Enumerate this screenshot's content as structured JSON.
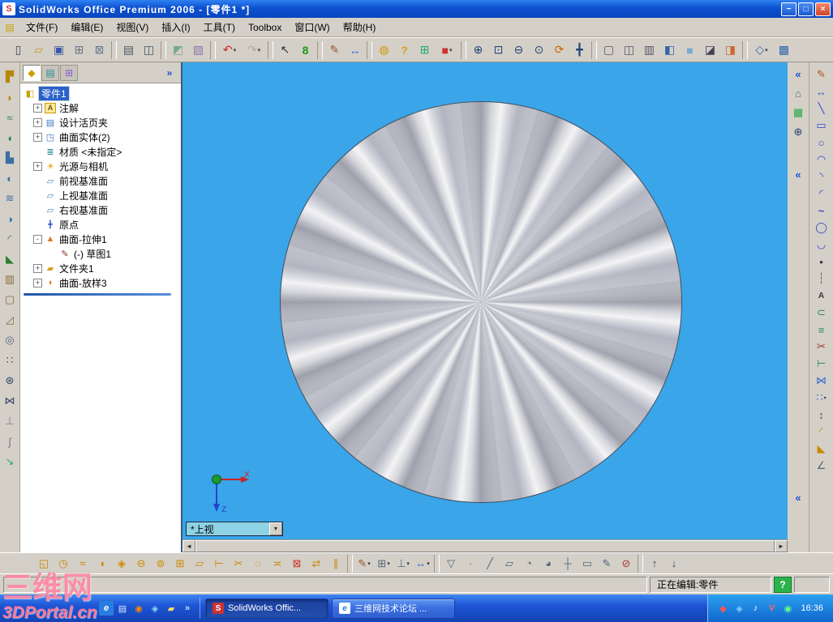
{
  "window": {
    "title": "SolidWorks Office Premium 2006 - [零件1 *]",
    "logo_glyph": "S",
    "controls": [
      {
        "n": "minimize-button",
        "g": "−",
        "cl": "wbtn"
      },
      {
        "n": "restore-button",
        "g": "□",
        "cl": "wbtn"
      },
      {
        "n": "close-button",
        "g": "×",
        "cl": "wbtn close"
      }
    ]
  },
  "menu": {
    "doc_icon_glyph": "▤",
    "items": [
      {
        "n": "menu-item-file",
        "label": "文件(F)"
      },
      {
        "n": "menu-item-edit",
        "label": "编辑(E)"
      },
      {
        "n": "menu-item-view",
        "label": "视图(V)"
      },
      {
        "n": "menu-item-insert",
        "label": "插入(I)"
      },
      {
        "n": "menu-item-tools",
        "label": "工具(T)"
      },
      {
        "n": "menu-item-toolbox",
        "label": "Toolbox"
      },
      {
        "n": "menu-item-window",
        "label": "窗口(W)"
      },
      {
        "n": "menu-item-help",
        "label": "帮助(H)"
      }
    ]
  },
  "toolbar_main": {
    "items": [
      {
        "n": "new-icon",
        "g": "▯",
        "st": "color:#444455"
      },
      {
        "n": "open-icon",
        "g": "▱",
        "st": "color:#c9992a"
      },
      {
        "n": "save-icon",
        "g": "▣",
        "st": "color:#3a57a8"
      },
      {
        "n": "make-drawing-icon",
        "g": "⊞",
        "st": "color:#667788"
      },
      {
        "n": "make-assembly-icon",
        "g": "⊠",
        "st": "color:#667788"
      },
      {
        "n": "separator",
        "cl": "tsep",
        "it": "false"
      },
      {
        "n": "print-icon",
        "g": "▤",
        "st": "color:#445566"
      },
      {
        "n": "print-preview-icon",
        "g": "◫",
        "st": "color:#445566"
      },
      {
        "n": "separator",
        "cl": "tsep",
        "it": "false"
      },
      {
        "n": "edit-color-icon",
        "g": "◩",
        "st": "color:#77aa88"
      },
      {
        "n": "texture-icon",
        "g": "▨",
        "st": "color:#8877aa"
      },
      {
        "n": "separator",
        "cl": "tsep",
        "it": "false"
      },
      {
        "n": "undo-icon",
        "g": "↶",
        "st": "color:#cc2222",
        "cl": "tbtn drop"
      },
      {
        "n": "redo-icon",
        "g": "↷",
        "st": "color:#aaaaaa",
        "cl": "tbtn drop"
      },
      {
        "n": "separator",
        "cl": "tsep",
        "it": "false"
      },
      {
        "n": "select-icon",
        "g": "↖",
        "st": "color:#223344"
      },
      {
        "n": "rebuild-icon",
        "g": "8",
        "st": "color:#1a9a1a;font-weight:bold"
      },
      {
        "n": "separator",
        "cl": "tsep",
        "it": "false"
      },
      {
        "n": "sketch-icon",
        "g": "✎",
        "st": "color:#995533"
      },
      {
        "n": "dimension-icon",
        "g": "↔",
        "st": "color:#3366cc"
      },
      {
        "n": "separator",
        "cl": "tsep",
        "it": "false"
      },
      {
        "n": "photoworks-icon",
        "g": "◍",
        "st": "color:#cc9900"
      },
      {
        "n": "help-topic-icon",
        "g": "?",
        "st": "color:#d4a017;font-weight:bold"
      },
      {
        "n": "design-table-icon",
        "g": "⊞",
        "st": "color:#22aa66"
      },
      {
        "n": "red-cube-icon",
        "g": "■",
        "st": "color:#cc3333",
        "cl": "tbtn drop"
      },
      {
        "n": "separator",
        "cl": "tsep",
        "it": "false"
      },
      {
        "n": "zoom-to-fit-icon",
        "g": "⊕",
        "st": "color:#224477"
      },
      {
        "n": "zoom-area-icon",
        "g": "⊡",
        "st": "color:#224477"
      },
      {
        "n": "zoom-in-out-icon",
        "g": "⊖",
        "st": "color:#224477"
      },
      {
        "n": "zoom-to-selection-icon",
        "g": "⊙",
        "st": "color:#224477"
      },
      {
        "n": "rotate-view-icon",
        "g": "⟳",
        "st": "color:#cc6600"
      },
      {
        "n": "pan-icon",
        "g": "╋",
        "st": "color:#224477"
      },
      {
        "n": "separator",
        "cl": "tsep",
        "it": "false"
      },
      {
        "n": "wireframe-icon",
        "g": "▢",
        "st": "color:#555566"
      },
      {
        "n": "hidden-lines-visible-icon",
        "g": "◫",
        "st": "color:#555566"
      },
      {
        "n": "hidden-lines-removed-icon",
        "g": "▥",
        "st": "color:#555566"
      },
      {
        "n": "shaded-with-edges-icon",
        "g": "◧",
        "st": "color:#3366aa"
      },
      {
        "n": "shaded-icon",
        "g": "■",
        "st": "color:#77aacc"
      },
      {
        "n": "shadows-icon",
        "g": "◪",
        "st": "color:#444455"
      },
      {
        "n": "section-view-icon",
        "g": "◨",
        "st": "color:#cc6633"
      },
      {
        "n": "separator",
        "cl": "tsep",
        "it": "false"
      },
      {
        "n": "standard-views-icon",
        "g": "◇",
        "st": "color:#3366aa",
        "cl": "tbtn drop"
      },
      {
        "n": "help-icon",
        "g": "▩",
        "st": "color:#3366aa"
      }
    ]
  },
  "left_toolbar": {
    "items": [
      {
        "n": "extruded-boss-icon",
        "g": "▛",
        "st": "color:#b8860b"
      },
      {
        "n": "revolved-boss-icon",
        "g": "◗",
        "st": "color:#b8860b"
      },
      {
        "n": "swept-boss-icon",
        "g": "≈",
        "st": "color:#2e7d52"
      },
      {
        "n": "lofted-boss-icon",
        "g": "◖",
        "st": "color:#2e7d52"
      },
      {
        "n": "extruded-cut-icon",
        "g": "▙",
        "st": "color:#3b6ea5"
      },
      {
        "n": "revolved-cut-icon",
        "g": "◐",
        "st": "color:#3b6ea5"
      },
      {
        "n": "swept-cut-icon",
        "g": "≋",
        "st": "color:#3b6ea5"
      },
      {
        "n": "lofted-cut-icon",
        "g": "◑",
        "st": "color:#3b6ea5"
      },
      {
        "n": "fillet-icon",
        "g": "◜",
        "st": "color:#2e7d32"
      },
      {
        "n": "chamfer-icon",
        "g": "◣",
        "st": "color:#2e7d32"
      },
      {
        "n": "rib-icon",
        "g": "▥",
        "st": "color:#8a6d3b"
      },
      {
        "n": "shell-icon",
        "g": "▢",
        "st": "color:#8a6d3b"
      },
      {
        "n": "draft-icon",
        "g": "◿",
        "st": "color:#8a6d3b"
      },
      {
        "n": "hole-wizard-icon",
        "g": "◎",
        "st": "color:#556677"
      },
      {
        "n": "linear-pattern-icon",
        "g": "∷",
        "st": "color:#334466"
      },
      {
        "n": "circular-pattern-icon",
        "g": "⊛",
        "st": "color:#334466"
      },
      {
        "n": "mirror-feature-icon",
        "g": "⋈",
        "st": "color:#334466"
      },
      {
        "n": "reference-geometry-icon",
        "g": "⊥",
        "st": "color:#777788"
      },
      {
        "n": "curves-icon",
        "g": "∫",
        "st": "color:#777788"
      },
      {
        "n": "instant3d-icon",
        "g": "↘",
        "st": "color:#22aa77"
      }
    ]
  },
  "right_toolbar": {
    "items": [
      {
        "n": "sketch-pencil-icon",
        "g": "✎",
        "st": "color:#aa5522"
      },
      {
        "n": "smart-dimension-icon",
        "g": "↔",
        "st": "color:#3366cc"
      },
      {
        "n": "line-icon",
        "g": "╲",
        "st": "color:#3344cc"
      },
      {
        "n": "rectangle-icon",
        "g": "▭",
        "st": "color:#3344cc"
      },
      {
        "n": "circle-icon",
        "g": "○",
        "st": "color:#3344cc"
      },
      {
        "n": "centerpoint-arc-icon",
        "g": "◠",
        "st": "color:#3344cc"
      },
      {
        "n": "tangent-arc-icon",
        "g": "◝",
        "st": "color:#3344cc"
      },
      {
        "n": "three-point-arc-icon",
        "g": "◜",
        "st": "color:#3344cc"
      },
      {
        "n": "spline-icon",
        "g": "~",
        "st": "color:#3344cc;font-weight:bold"
      },
      {
        "n": "ellipse-icon",
        "g": "◯",
        "st": "color:#3344cc"
      },
      {
        "n": "parabola-icon",
        "g": "◡",
        "st": "color:#3344cc"
      },
      {
        "n": "point-icon",
        "g": "•",
        "st": "color:#333344"
      },
      {
        "n": "centerline-icon",
        "g": "┆",
        "st": "color:#666677"
      },
      {
        "n": "sketch-text-icon",
        "g": "A",
        "st": "color:#333344;font-weight:bold;font-size:10px"
      },
      {
        "n": "convert-entities-icon",
        "g": "⊂",
        "st": "color:#338855"
      },
      {
        "n": "offset-entities-icon",
        "g": "≡",
        "st": "color:#338855"
      },
      {
        "n": "trim-entities-icon",
        "g": "✂",
        "st": "color:#aa3333"
      },
      {
        "n": "extend-entities-icon",
        "g": "⊢",
        "st": "color:#338855"
      },
      {
        "n": "mirror-entities-icon",
        "g": "⋈",
        "st": "color:#3366cc"
      },
      {
        "n": "linear-sketch-pattern-icon",
        "g": "∷",
        "st": "color:#3366cc",
        "cl": "vbtn drop"
      },
      {
        "n": "move-entities-icon",
        "g": "↕",
        "st": "color:#556677"
      },
      {
        "n": "sketch-fillet-icon",
        "g": "◜",
        "st": "color:#cc8800"
      },
      {
        "n": "sketch-chamfer-icon",
        "g": "◣",
        "st": "color:#cc8800"
      },
      {
        "n": "display-relations-icon",
        "g": "∠",
        "st": "color:#556677"
      }
    ]
  },
  "side_buttons": {
    "items": [
      {
        "n": "collapse-panel-button",
        "g": "«",
        "st": "color:#2255cc;font-weight:bold"
      },
      {
        "n": "home-view-button",
        "g": "⌂",
        "st": "color:#556677"
      },
      {
        "n": "appearance-palette-button",
        "g": "▦",
        "st": "color:#22aa44"
      },
      {
        "n": "magnifier-button",
        "g": "⊕",
        "st": "color:#224477"
      },
      {
        "n": "collapse-mid-button",
        "g": "«",
        "st": "color:#2255cc;font-weight:bold;margin-top:28px"
      },
      {
        "n": "collapse-bottom-button",
        "g": "«",
        "st": "color:#2255cc;font-weight:bold;margin-top:auto;margin-bottom:52px"
      }
    ]
  },
  "feature_tree": {
    "tabs": [
      {
        "n": "featuremanager-tab",
        "g": "◆",
        "st": "color:#c8a000",
        "cl": "ttab active"
      },
      {
        "n": "propertymanager-tab",
        "g": "▤",
        "st": "color:#2a8a8a"
      },
      {
        "n": "configurationmanager-tab",
        "g": "⊞",
        "st": "color:#8a5ac8"
      }
    ],
    "expand_glyph": "»",
    "root_label": "零件1",
    "root_glyph": "◧",
    "items": [
      {
        "row": "tree-item-annotations",
        "exp": "+",
        "expcls": "texp box",
        "icon": "annotations-icon",
        "g": "A",
        "ist": "color:#7a5a00;background:#ffe9a0;border:1px solid #c8a000;font-size:9px;font-weight:bold",
        "label": "注解"
      },
      {
        "row": "tree-item-design-binder",
        "exp": "+",
        "expcls": "texp box",
        "icon": "design-binder-icon",
        "g": "▤",
        "ist": "color:#3a7ac8",
        "label": "设计活页夹"
      },
      {
        "row": "tree-item-surface-bodies",
        "exp": "+",
        "expcls": "texp box",
        "icon": "surface-bodies-icon",
        "g": "◳",
        "ist": "color:#3a7ac8",
        "label": "曲面实体(2)"
      },
      {
        "row": "tree-item-material",
        "icon": "material-icon",
        "g": "≣",
        "ist": "color:#2a8a8a",
        "label": "材质 <未指定>"
      },
      {
        "row": "tree-item-lights-cameras",
        "exp": "+",
        "expcls": "texp box",
        "icon": "lights-cameras-icon",
        "g": "☀",
        "ist": "color:#e8a000",
        "label": "光源与相机"
      },
      {
        "row": "tree-item-front-plane",
        "icon": "front-plane-icon",
        "g": "▱",
        "ist": "color:#3a8ab0",
        "label": "前视基准面"
      },
      {
        "row": "tree-item-top-plane",
        "icon": "top-plane-icon",
        "g": "▱",
        "ist": "color:#3a8ab0",
        "label": "上视基准面"
      },
      {
        "row": "tree-item-right-plane",
        "icon": "right-plane-icon",
        "g": "▱",
        "ist": "color:#3a8ab0",
        "label": "右视基准面"
      },
      {
        "row": "tree-item-origin",
        "icon": "origin-icon",
        "g": "╋",
        "ist": "color:#2244cc;font-size:9px",
        "label": "原点"
      },
      {
        "row": "tree-item-surface-extrude1",
        "exp": "-",
        "expcls": "texp box",
        "icon": "surface-extrude-icon",
        "g": "▲",
        "ist": "color:#e07820",
        "label": "曲面-拉伸1"
      },
      {
        "row": "tree-item-sketch1",
        "pad": "padding-left:34px",
        "icon": "sketch1-icon",
        "g": "✎",
        "ist": "color:#883322",
        "label": "(-) 草图1"
      },
      {
        "row": "tree-item-folder1",
        "exp": "+",
        "expcls": "texp box",
        "icon": "folder-icon",
        "g": "▰",
        "ist": "color:#d8a020",
        "label": "文件夹1"
      },
      {
        "row": "tree-item-surface-loft3",
        "exp": "+",
        "expcls": "texp box",
        "icon": "surface-loft-icon",
        "g": "◖",
        "ist": "color:#e07820",
        "label": "曲面-放样3"
      }
    ]
  },
  "viewport": {
    "view_selector": "*上视",
    "dropdown_glyph": "▼",
    "scroll_left_glyph": "◄",
    "scroll_right_glyph": "►",
    "triad_x_label": "X",
    "triad_z_label": "Z"
  },
  "bottom_toolbar": {
    "items": [
      {
        "n": "extruded-surface-icon",
        "g": "◱",
        "st": "color:#cc8800"
      },
      {
        "n": "revolved-surface-icon",
        "g": "◷",
        "st": "color:#cc8800"
      },
      {
        "n": "swept-surface-icon",
        "g": "≈",
        "st": "color:#cc8800"
      },
      {
        "n": "lofted-surface-icon",
        "g": "◖",
        "st": "color:#cc8800"
      },
      {
        "n": "boundary-surface-icon",
        "g": "◈",
        "st": "color:#cc8800"
      },
      {
        "n": "offset-surface-icon",
        "g": "⊖",
        "st": "color:#cc8800"
      },
      {
        "n": "radiate-surface-icon",
        "g": "⊚",
        "st": "color:#cc8800"
      },
      {
        "n": "knit-surface-icon",
        "g": "⊞",
        "st": "color:#cc8800"
      },
      {
        "n": "planar-surface-icon",
        "g": "▱",
        "st": "color:#cc8800"
      },
      {
        "n": "extend-surface-icon",
        "g": "⊢",
        "st": "color:#cc8800"
      },
      {
        "n": "trim-surface-icon",
        "g": "✂",
        "st": "color:#cc8800"
      },
      {
        "n": "untrim-surface-icon",
        "g": "◌",
        "st": "color:#cc8800"
      },
      {
        "n": "mid-surface-icon",
        "g": "≍",
        "st": "color:#cc8800"
      },
      {
        "n": "delete-face-icon",
        "g": "⊠",
        "st": "color:#cc3333"
      },
      {
        "n": "replace-face-icon",
        "g": "⇄",
        "st": "color:#cc8800"
      },
      {
        "n": "ruled-surface-icon",
        "g": "∥",
        "st": "color:#cc8800"
      },
      {
        "n": "separator",
        "cl": "tsep",
        "it": "false"
      },
      {
        "n": "sketch-dropdown-icon",
        "g": "✎",
        "st": "color:#995533",
        "cl": "tbtn drop"
      },
      {
        "n": "grid-system-icon",
        "g": "⊞",
        "st": "color:#556677",
        "cl": "tbtn drop"
      },
      {
        "n": "relations-dropdown-icon",
        "g": "⊥",
        "st": "color:#556677",
        "cl": "tbtn drop"
      },
      {
        "n": "dimension-dropdown-icon",
        "g": "↔",
        "st": "color:#3366cc",
        "cl": "tbtn drop"
      },
      {
        "n": "separator",
        "cl": "tsep",
        "it": "false"
      },
      {
        "n": "filter-toggle-icon",
        "g": "▽",
        "st": "color:#556677"
      },
      {
        "n": "filter-vertices-icon",
        "g": "∙",
        "st": "color:#556677"
      },
      {
        "n": "filter-edges-icon",
        "g": "╱",
        "st": "color:#556677"
      },
      {
        "n": "filter-faces-icon",
        "g": "▱",
        "st": "color:#556677"
      },
      {
        "n": "filter-surface-bodies-icon",
        "g": "◔",
        "st": "color:#556677"
      },
      {
        "n": "filter-solid-bodies-icon",
        "g": "◕",
        "st": "color:#556677"
      },
      {
        "n": "filter-axes-icon",
        "g": "┼",
        "st": "color:#556677"
      },
      {
        "n": "filter-planes-icon",
        "g": "▭",
        "st": "color:#556677"
      },
      {
        "n": "filter-sketches-icon",
        "g": "✎",
        "st": "color:#556677"
      },
      {
        "n": "filter-clear-icon",
        "g": "⊘",
        "st": "color:#aa3333"
      },
      {
        "n": "separator",
        "cl": "tsep",
        "it": "false"
      },
      {
        "n": "dock-up-icon",
        "g": "↑",
        "st": "color:#334455"
      },
      {
        "n": "dock-down-icon",
        "g": "↓",
        "st": "color:#334455"
      }
    ]
  },
  "status_bar": {
    "editing": "正在编辑:零件",
    "help_glyph": "?"
  },
  "taskbar": {
    "quick_launch": [
      {
        "n": "internet-explorer-icon",
        "g": "e",
        "st": "color:#fff;background:#2a7de0;font-style:italic;font-weight:bold;border-radius:2px"
      },
      {
        "n": "show-desktop-icon",
        "g": "▤",
        "st": "color:#dde8ff"
      },
      {
        "n": "media-player-icon",
        "g": "◉",
        "st": "color:#ff8800"
      },
      {
        "n": "messenger-icon",
        "g": "◈",
        "st": "color:#88ddff"
      },
      {
        "n": "folders-icon",
        "g": "▰",
        "st": "color:#ffd966"
      },
      {
        "n": "quicklaunch-expand-icon",
        "g": "»",
        "st": "color:#cde0ff;font-weight:bold"
      }
    ],
    "tasks": [
      {
        "n": "task-solidworks",
        "cl": "task active",
        "icon": "solidworks-task-icon",
        "ig": "S",
        "ist": "background:#cc3333;color:#fff;font-weight:bold",
        "label": "SolidWorks Offic..."
      },
      {
        "n": "task-forum",
        "cl": "task",
        "icon": "internet-explorer-icon",
        "ig": "e",
        "ist": "background:#fff;color:#2a7de0;font-style:italic;font-weight:bold",
        "label": "三维网技术论坛 ..."
      }
    ],
    "tray": [
      {
        "n": "safety-center-icon",
        "g": "◆",
        "st": "color:#ff5555"
      },
      {
        "n": "im-icon",
        "g": "◈",
        "st": "color:#88ccff"
      },
      {
        "n": "volume-icon",
        "g": "♪",
        "st": "color:#ffffff"
      },
      {
        "n": "antivirus-icon",
        "g": "V",
        "st": "color:#ff6666;font-weight:bold"
      },
      {
        "n": "status-green-icon",
        "g": "◉",
        "st": "color:#66ff88"
      }
    ],
    "time": "16:36"
  },
  "watermark": {
    "line1": "三维网",
    "line2": "3DPortal.cn"
  },
  "colors": {
    "viewport_background": "#3aa5e9",
    "selection_blue": "#2a61c8",
    "taskbar_blue": "#1e55d6",
    "watermark_pink": "#ff80a0"
  }
}
